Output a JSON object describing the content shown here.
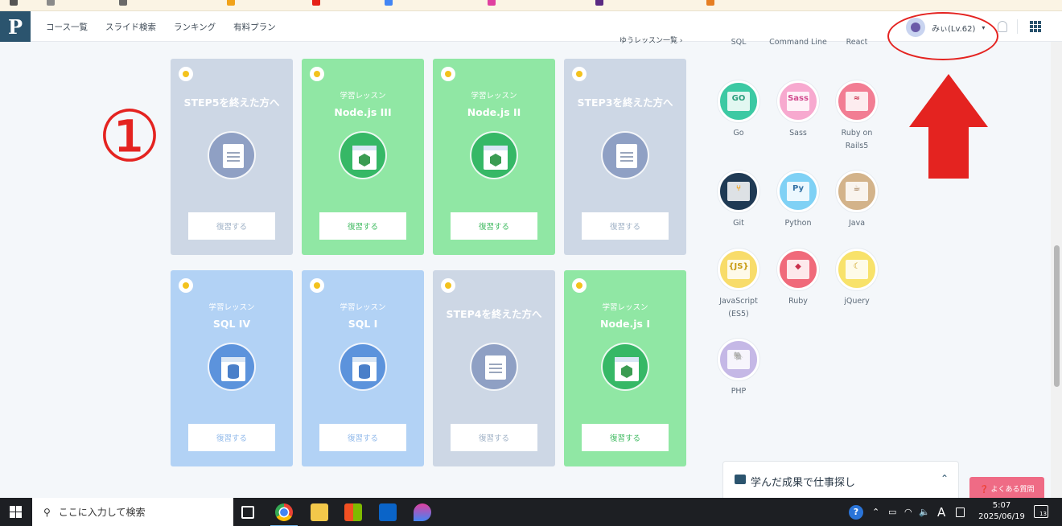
{
  "header": {
    "logo_glyph": "P",
    "nav": [
      "コース一覧",
      "スライド検索",
      "ランキング",
      "有料プラン"
    ],
    "user_name": "みぃ(Lv.62)",
    "caret": "▾"
  },
  "annotation": {
    "number": "①"
  },
  "partial_header_text": "ゆうレッスン一覧 ›",
  "cards": [
    {
      "subtitle": "",
      "title": "STEP5を終えた方へ",
      "button": "復習する"
    },
    {
      "subtitle": "学習レッスン",
      "title": "Node.js III",
      "button": "復習する"
    },
    {
      "subtitle": "学習レッスン",
      "title": "Node.js II",
      "button": "復習する"
    },
    {
      "subtitle": "",
      "title": "STEP3を終えた方へ",
      "button": "復習する"
    },
    {
      "subtitle": "学習レッスン",
      "title": "SQL IV",
      "button": "復習する"
    },
    {
      "subtitle": "学習レッスン",
      "title": "SQL I",
      "button": "復習する"
    },
    {
      "subtitle": "",
      "title": "STEP4を終えた方へ",
      "button": "復習する"
    },
    {
      "subtitle": "学習レッスン",
      "title": "Node.js I",
      "button": "復習する"
    }
  ],
  "courses_top": [
    "SQL",
    "Command Line",
    "React"
  ],
  "courses": [
    {
      "name": "Go",
      "glyph": "GO",
      "color": "#3cc9a3"
    },
    {
      "name": "Sass",
      "glyph": "Sass",
      "color": "#f7a9cf"
    },
    {
      "name": "Ruby on Rails5",
      "glyph": "≈",
      "color": "#f27d93"
    },
    {
      "name": "Git",
      "glyph": "⑂",
      "color": "#1f3a54"
    },
    {
      "name": "Python",
      "glyph": "Py",
      "color": "#7fd1f5"
    },
    {
      "name": "Java",
      "glyph": "☕",
      "color": "#d3b38a"
    },
    {
      "name": "JavaScript (ES5)",
      "glyph": "{JS}",
      "color": "#f8dc6a"
    },
    {
      "name": "Ruby",
      "glyph": "◆",
      "color": "#f06a7a"
    },
    {
      "name": "jQuery",
      "glyph": "☾",
      "color": "#f8e26a"
    },
    {
      "name": "PHP",
      "glyph": "🐘",
      "color": "#c5b8e6"
    }
  ],
  "job_panel": {
    "title": "学んだ成果で仕事探し",
    "chevron": "⌃"
  },
  "faq_button": "❓ よくある質問",
  "taskbar": {
    "search_placeholder": "ここに入力して検索",
    "time": "5:07",
    "date": "2025/06/19",
    "ime": "A",
    "notifications": "13"
  }
}
